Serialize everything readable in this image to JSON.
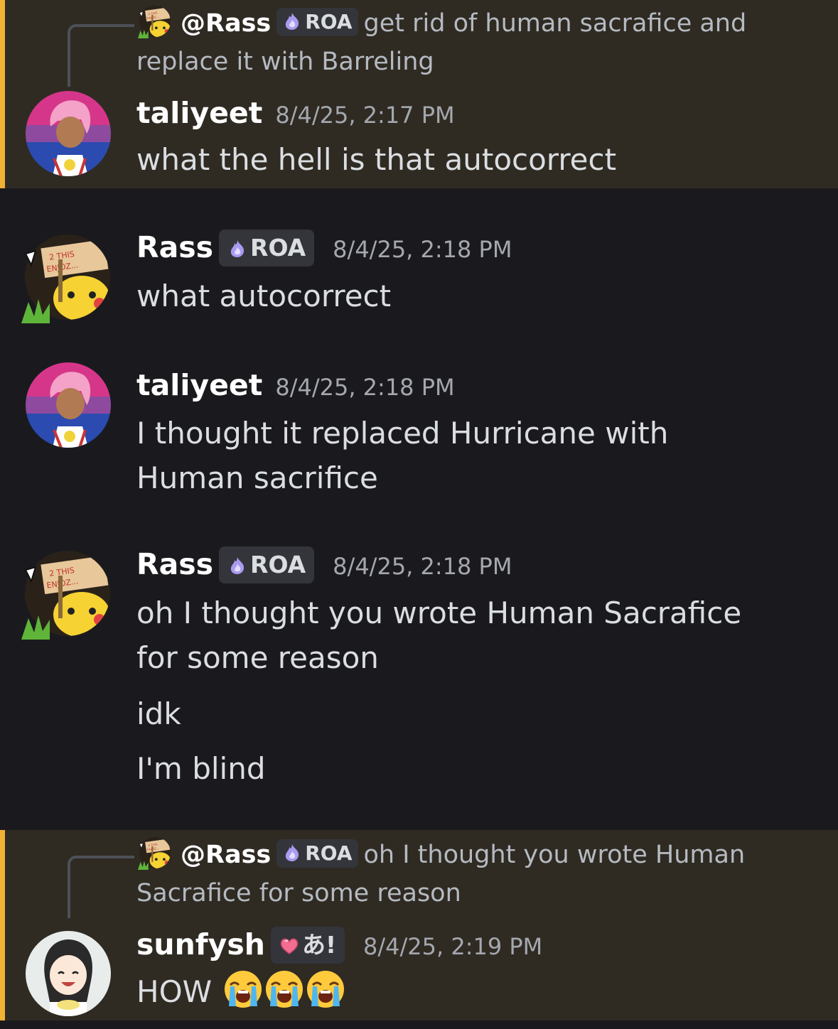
{
  "colors": {
    "background": "#1a1a1e",
    "mention_highlight": "#2f2b23",
    "mention_bar": "#f0b232",
    "username": "#ffffff",
    "text": "#dbdee1",
    "muted": "#a4a7ae",
    "tag_bg": "#34353b"
  },
  "messages": [
    {
      "highlighted": true,
      "reply": {
        "user": "@Rass",
        "tag": "ROA",
        "tag_icon": "purple-flame-icon",
        "text": "get rid of human sacrafice and replace it with Barreling"
      },
      "author": "taliyeet",
      "avatar": "pink-hair-avatar",
      "time": "8/4/25, 2:17 PM",
      "lines": [
        "what the hell is that autocorrect"
      ]
    },
    {
      "author": "Rass",
      "tag": "ROA",
      "tag_icon": "purple-flame-icon",
      "avatar": "pikachu-sign-avatar",
      "time": "8/4/25, 2:18 PM",
      "lines": [
        "what autocorrect"
      ]
    },
    {
      "author": "taliyeet",
      "avatar": "pink-hair-avatar",
      "time": "8/4/25, 2:18 PM",
      "lines": [
        "I thought it replaced Hurricane with Human sacrifice"
      ]
    },
    {
      "author": "Rass",
      "tag": "ROA",
      "tag_icon": "purple-flame-icon",
      "avatar": "pikachu-sign-avatar",
      "time": "8/4/25, 2:18 PM",
      "lines": [
        "oh I thought you wrote Human Sacrafice for some reason",
        "idk",
        "I'm blind"
      ]
    },
    {
      "highlighted": true,
      "reply": {
        "user": "@Rass",
        "tag": "ROA",
        "tag_icon": "purple-flame-icon",
        "text": "oh I thought you wrote Human Sacrafice for some reason"
      },
      "author": "sunfysh",
      "tag": "あ!",
      "tag_icon": "pink-heart-icon",
      "avatar": "anime-girl-avatar",
      "time": "8/4/25, 2:19 PM",
      "lines": [
        "HOW"
      ],
      "emojis": [
        "loudly-crying-emoji",
        "loudly-crying-emoji",
        "loudly-crying-emoji"
      ]
    }
  ]
}
